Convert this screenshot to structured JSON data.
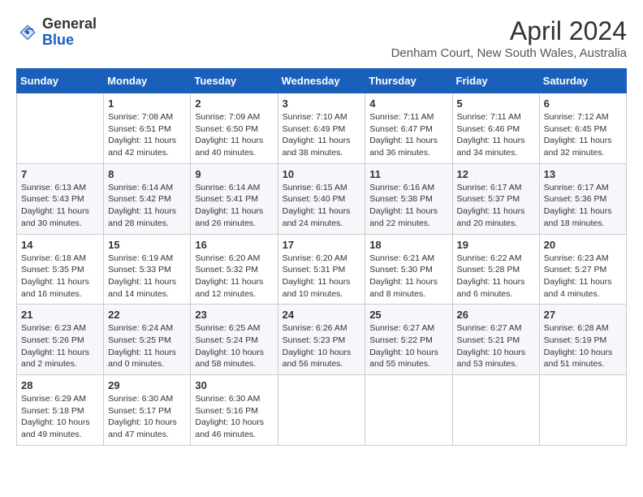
{
  "header": {
    "logo_general": "General",
    "logo_blue": "Blue",
    "title": "April 2024",
    "subtitle": "Denham Court, New South Wales, Australia"
  },
  "days_of_week": [
    "Sunday",
    "Monday",
    "Tuesday",
    "Wednesday",
    "Thursday",
    "Friday",
    "Saturday"
  ],
  "weeks": [
    [
      {
        "day": "",
        "sunrise": "",
        "sunset": "",
        "daylight": ""
      },
      {
        "day": "1",
        "sunrise": "Sunrise: 7:08 AM",
        "sunset": "Sunset: 6:51 PM",
        "daylight": "Daylight: 11 hours and 42 minutes."
      },
      {
        "day": "2",
        "sunrise": "Sunrise: 7:09 AM",
        "sunset": "Sunset: 6:50 PM",
        "daylight": "Daylight: 11 hours and 40 minutes."
      },
      {
        "day": "3",
        "sunrise": "Sunrise: 7:10 AM",
        "sunset": "Sunset: 6:49 PM",
        "daylight": "Daylight: 11 hours and 38 minutes."
      },
      {
        "day": "4",
        "sunrise": "Sunrise: 7:11 AM",
        "sunset": "Sunset: 6:47 PM",
        "daylight": "Daylight: 11 hours and 36 minutes."
      },
      {
        "day": "5",
        "sunrise": "Sunrise: 7:11 AM",
        "sunset": "Sunset: 6:46 PM",
        "daylight": "Daylight: 11 hours and 34 minutes."
      },
      {
        "day": "6",
        "sunrise": "Sunrise: 7:12 AM",
        "sunset": "Sunset: 6:45 PM",
        "daylight": "Daylight: 11 hours and 32 minutes."
      }
    ],
    [
      {
        "day": "7",
        "sunrise": "Sunrise: 6:13 AM",
        "sunset": "Sunset: 5:43 PM",
        "daylight": "Daylight: 11 hours and 30 minutes."
      },
      {
        "day": "8",
        "sunrise": "Sunrise: 6:14 AM",
        "sunset": "Sunset: 5:42 PM",
        "daylight": "Daylight: 11 hours and 28 minutes."
      },
      {
        "day": "9",
        "sunrise": "Sunrise: 6:14 AM",
        "sunset": "Sunset: 5:41 PM",
        "daylight": "Daylight: 11 hours and 26 minutes."
      },
      {
        "day": "10",
        "sunrise": "Sunrise: 6:15 AM",
        "sunset": "Sunset: 5:40 PM",
        "daylight": "Daylight: 11 hours and 24 minutes."
      },
      {
        "day": "11",
        "sunrise": "Sunrise: 6:16 AM",
        "sunset": "Sunset: 5:38 PM",
        "daylight": "Daylight: 11 hours and 22 minutes."
      },
      {
        "day": "12",
        "sunrise": "Sunrise: 6:17 AM",
        "sunset": "Sunset: 5:37 PM",
        "daylight": "Daylight: 11 hours and 20 minutes."
      },
      {
        "day": "13",
        "sunrise": "Sunrise: 6:17 AM",
        "sunset": "Sunset: 5:36 PM",
        "daylight": "Daylight: 11 hours and 18 minutes."
      }
    ],
    [
      {
        "day": "14",
        "sunrise": "Sunrise: 6:18 AM",
        "sunset": "Sunset: 5:35 PM",
        "daylight": "Daylight: 11 hours and 16 minutes."
      },
      {
        "day": "15",
        "sunrise": "Sunrise: 6:19 AM",
        "sunset": "Sunset: 5:33 PM",
        "daylight": "Daylight: 11 hours and 14 minutes."
      },
      {
        "day": "16",
        "sunrise": "Sunrise: 6:20 AM",
        "sunset": "Sunset: 5:32 PM",
        "daylight": "Daylight: 11 hours and 12 minutes."
      },
      {
        "day": "17",
        "sunrise": "Sunrise: 6:20 AM",
        "sunset": "Sunset: 5:31 PM",
        "daylight": "Daylight: 11 hours and 10 minutes."
      },
      {
        "day": "18",
        "sunrise": "Sunrise: 6:21 AM",
        "sunset": "Sunset: 5:30 PM",
        "daylight": "Daylight: 11 hours and 8 minutes."
      },
      {
        "day": "19",
        "sunrise": "Sunrise: 6:22 AM",
        "sunset": "Sunset: 5:28 PM",
        "daylight": "Daylight: 11 hours and 6 minutes."
      },
      {
        "day": "20",
        "sunrise": "Sunrise: 6:23 AM",
        "sunset": "Sunset: 5:27 PM",
        "daylight": "Daylight: 11 hours and 4 minutes."
      }
    ],
    [
      {
        "day": "21",
        "sunrise": "Sunrise: 6:23 AM",
        "sunset": "Sunset: 5:26 PM",
        "daylight": "Daylight: 11 hours and 2 minutes."
      },
      {
        "day": "22",
        "sunrise": "Sunrise: 6:24 AM",
        "sunset": "Sunset: 5:25 PM",
        "daylight": "Daylight: 11 hours and 0 minutes."
      },
      {
        "day": "23",
        "sunrise": "Sunrise: 6:25 AM",
        "sunset": "Sunset: 5:24 PM",
        "daylight": "Daylight: 10 hours and 58 minutes."
      },
      {
        "day": "24",
        "sunrise": "Sunrise: 6:26 AM",
        "sunset": "Sunset: 5:23 PM",
        "daylight": "Daylight: 10 hours and 56 minutes."
      },
      {
        "day": "25",
        "sunrise": "Sunrise: 6:27 AM",
        "sunset": "Sunset: 5:22 PM",
        "daylight": "Daylight: 10 hours and 55 minutes."
      },
      {
        "day": "26",
        "sunrise": "Sunrise: 6:27 AM",
        "sunset": "Sunset: 5:21 PM",
        "daylight": "Daylight: 10 hours and 53 minutes."
      },
      {
        "day": "27",
        "sunrise": "Sunrise: 6:28 AM",
        "sunset": "Sunset: 5:19 PM",
        "daylight": "Daylight: 10 hours and 51 minutes."
      }
    ],
    [
      {
        "day": "28",
        "sunrise": "Sunrise: 6:29 AM",
        "sunset": "Sunset: 5:18 PM",
        "daylight": "Daylight: 10 hours and 49 minutes."
      },
      {
        "day": "29",
        "sunrise": "Sunrise: 6:30 AM",
        "sunset": "Sunset: 5:17 PM",
        "daylight": "Daylight: 10 hours and 47 minutes."
      },
      {
        "day": "30",
        "sunrise": "Sunrise: 6:30 AM",
        "sunset": "Sunset: 5:16 PM",
        "daylight": "Daylight: 10 hours and 46 minutes."
      },
      {
        "day": "",
        "sunrise": "",
        "sunset": "",
        "daylight": ""
      },
      {
        "day": "",
        "sunrise": "",
        "sunset": "",
        "daylight": ""
      },
      {
        "day": "",
        "sunrise": "",
        "sunset": "",
        "daylight": ""
      },
      {
        "day": "",
        "sunrise": "",
        "sunset": "",
        "daylight": ""
      }
    ]
  ]
}
